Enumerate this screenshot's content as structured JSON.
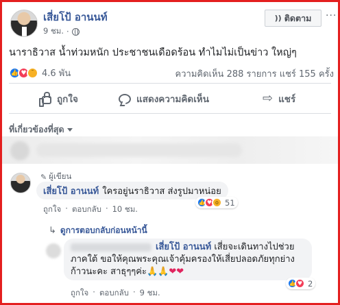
{
  "post": {
    "author": "เสี่ยโป้ อานนท์",
    "time": "9 ชม.",
    "follow_icon": "rss-icon",
    "follow_label": "ติดตาม",
    "menu": "···",
    "status": "นาราธิวาส น้ำท่วมหนัก ประชาชนเดือดร้อน ทำไมไม่เป็นข่าว ใหญ่ๆ",
    "reaction_count": "4.6 พัน",
    "stats": "ความคิดเห็น 288 รายการ แชร์ 155 ครั้ง",
    "colors": {
      "link": "#385898",
      "like": "#1877f2",
      "love": "#f33e58",
      "sad": "#f7b125",
      "frame": "#e41f1f"
    }
  },
  "actions": {
    "like": "ถูกใจ",
    "comment": "แสดงความคิดเห็น",
    "share": "แชร์"
  },
  "filter": {
    "label": "ที่เกี่ยวข้องที่สุด"
  },
  "comment1": {
    "badge": "ผู้เขียน",
    "author": "เสี่ยโป้ อานนท์",
    "text": "ใครอยู่นราธิวาส ส่งรูปมาหน่อย",
    "like": "ถูกใจ",
    "reply": "ตอบกลับ",
    "time": "10 ชม.",
    "reaction_count": "51"
  },
  "previous_replies": "ดูการตอบกลับก่อนหน้านี้",
  "reply1": {
    "mention": "เสี่ยโป้ อานนท์",
    "text_line1": "เสี่ยจะเดินทางไปช่วย",
    "text_line2": "ภาคใต้ ขอให้คุณพระคุณเจ้าคุ้มครองให้เสี่ยปลอดภัยทุกย่าง",
    "text_line3": "ก้าวนะคะ สาธุๆๆค่ะ",
    "emoji": "🙏🙏",
    "hearts": "❤❤",
    "like": "ถูกใจ",
    "reply": "ตอบกลับ",
    "time": "9 ชม.",
    "reaction_count": "2"
  }
}
